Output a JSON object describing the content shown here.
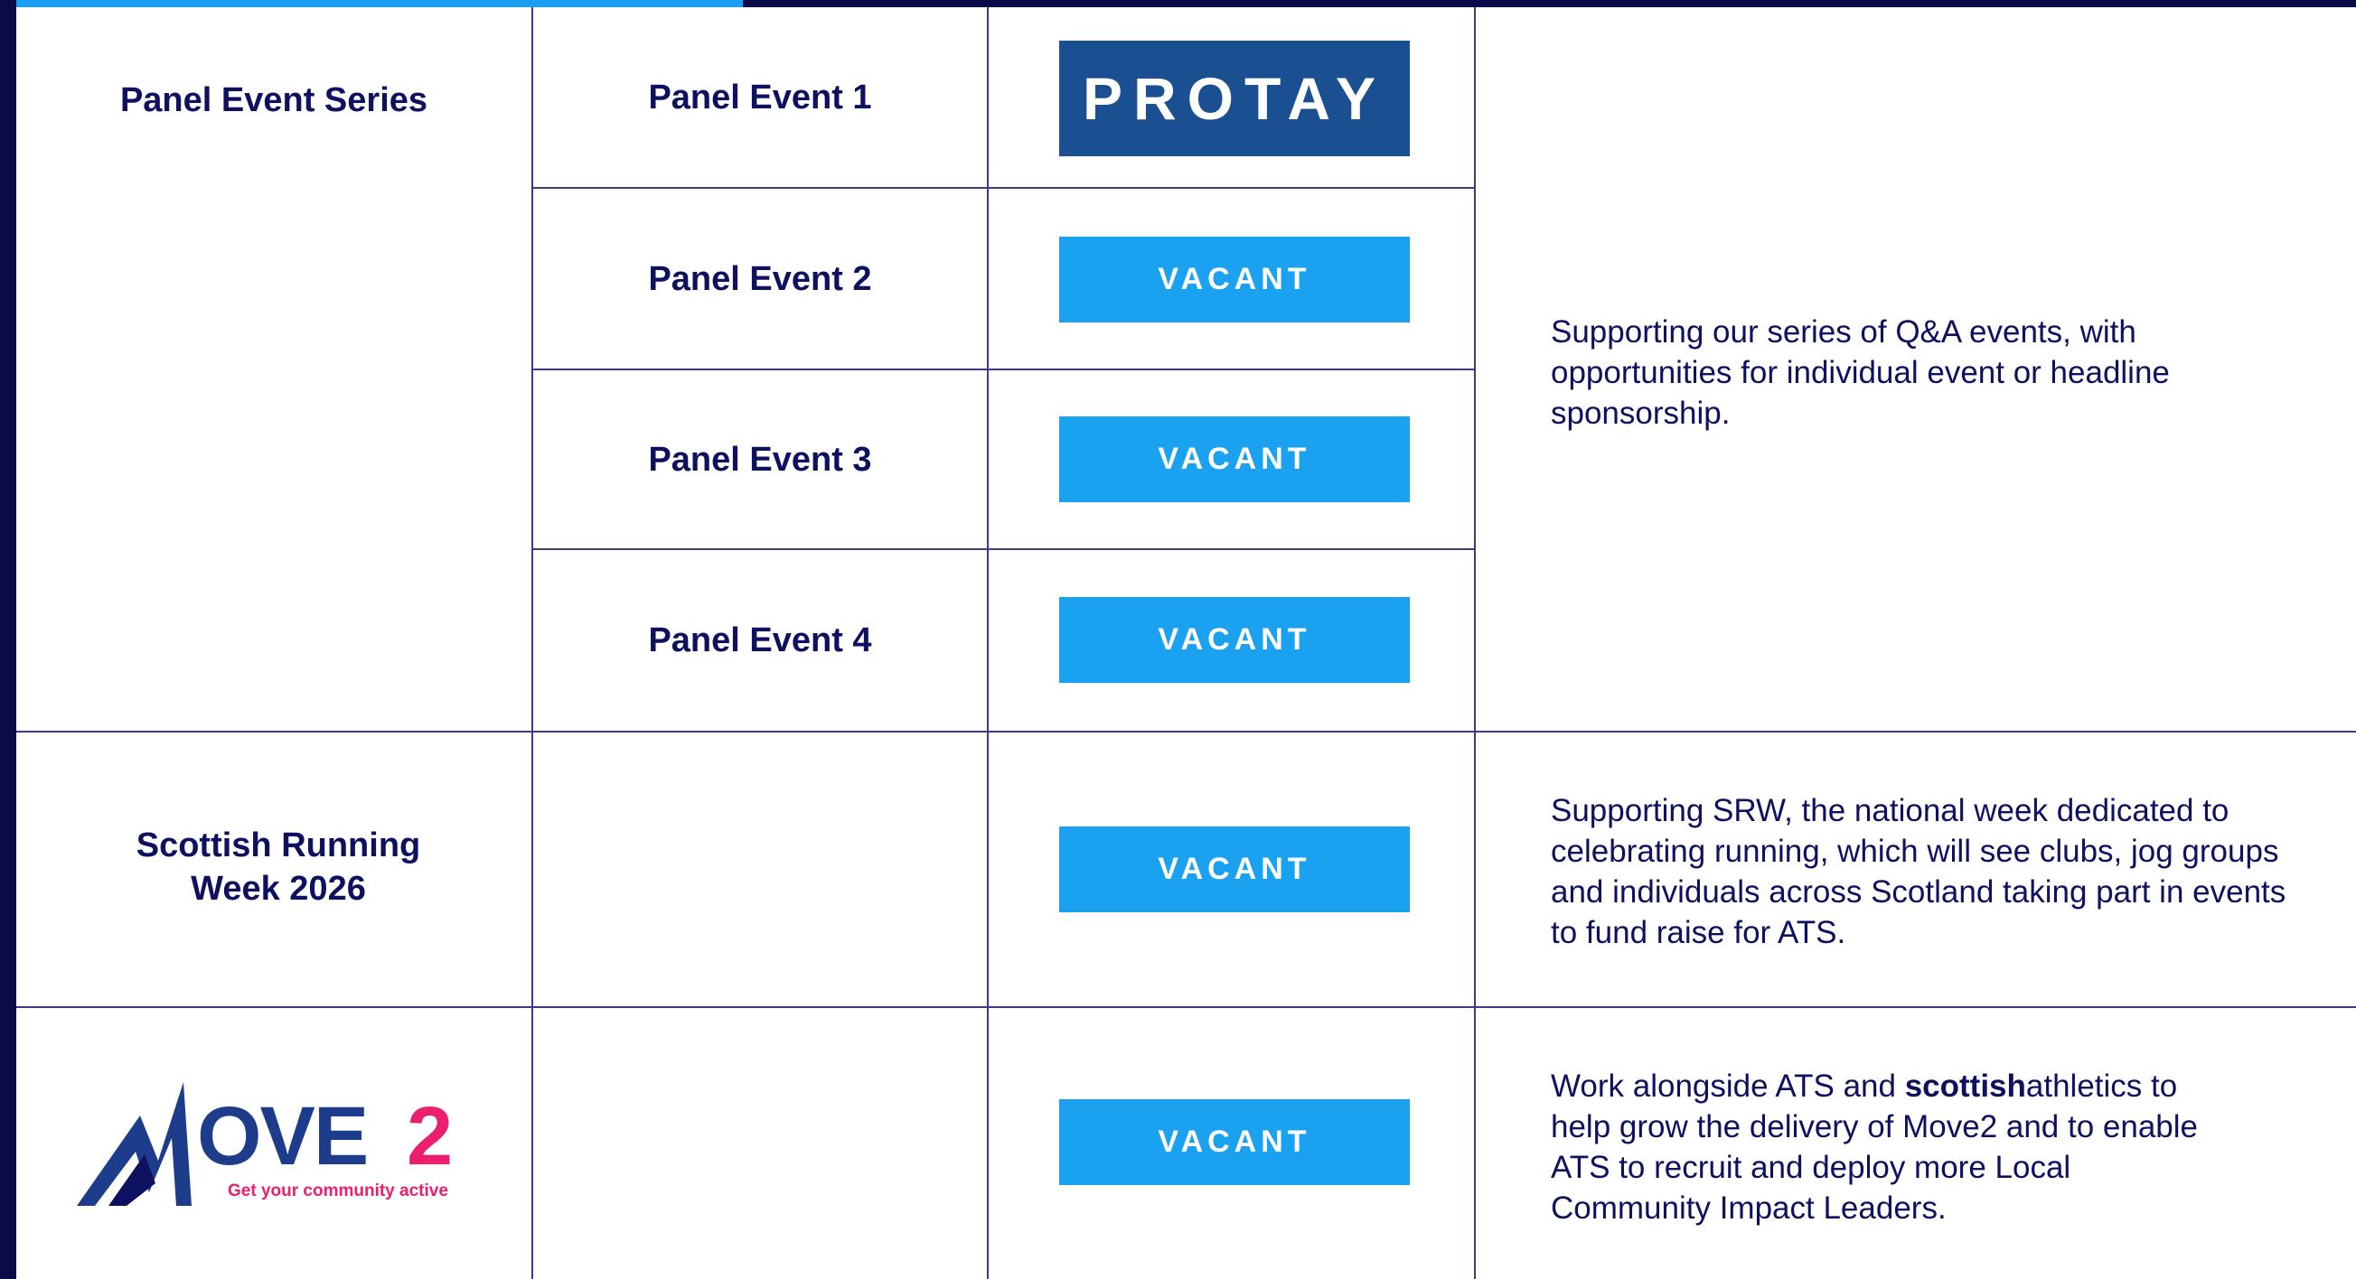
{
  "rows": [
    {
      "category": "Panel Event Series",
      "events": [
        "Panel Event 1",
        "Panel Event 2",
        "Panel Event 3",
        "Panel Event 4"
      ],
      "description": "Supporting our series of Q&A events, with opportunities for individual event or headline sponsorship."
    },
    {
      "category": "Scottish Running Week 2026",
      "description": "Supporting SRW, the national week dedicated to celebrating running, which will see clubs, jog groups and individuals across Scotland taking part in events to fund raise for ATS."
    },
    {
      "description_pre": "Work alongside ATS and ",
      "description_bold": "scottish",
      "description_post": "athletics to help grow the delivery of Move2 and to enable ATS to recruit and deploy more Local Community Impact Leaders."
    }
  ],
  "sponsors": {
    "protay": "PROTAY",
    "vacant_label": "VACANT"
  },
  "move2_logo": {
    "wordmark": "OVE",
    "number": "2",
    "tagline": "Get your community active"
  },
  "colors": {
    "navy": "#0b0b4a",
    "text_navy": "#0d1160",
    "vacant_blue": "#1aa1f0",
    "protay_blue": "#1a4f92",
    "move2_pink": "#ec1e6e",
    "top_accent": "#1a9ff2"
  }
}
